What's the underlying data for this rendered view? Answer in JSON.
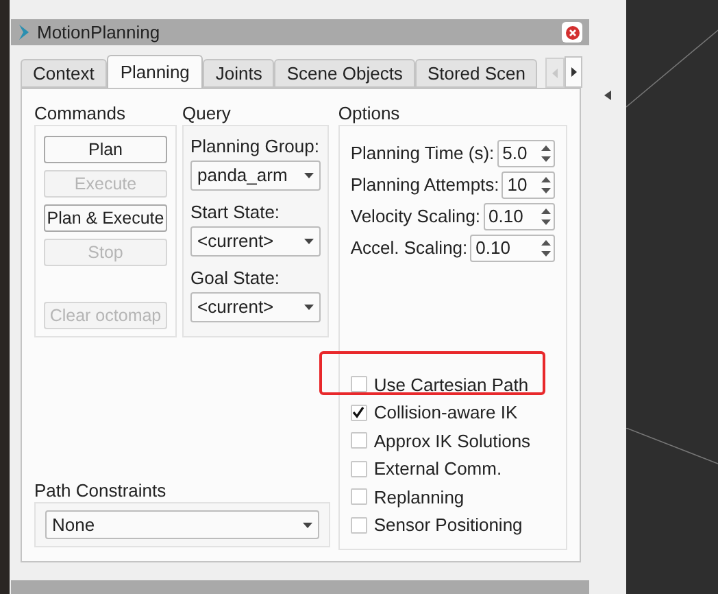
{
  "window": {
    "title": "MotionPlanning"
  },
  "tabs": [
    {
      "label": "Context",
      "selected": false
    },
    {
      "label": "Planning",
      "selected": true
    },
    {
      "label": "Joints",
      "selected": false
    },
    {
      "label": "Scene Objects",
      "selected": false
    },
    {
      "label": "Stored Scen",
      "selected": false
    }
  ],
  "commands": {
    "title": "Commands",
    "buttons": [
      {
        "label": "Plan",
        "disabled": false
      },
      {
        "label": "Execute",
        "disabled": true
      },
      {
        "label": "Plan & Execute",
        "disabled": false
      },
      {
        "label": "Stop",
        "disabled": true
      },
      {
        "label": "Clear octomap",
        "disabled": true
      }
    ]
  },
  "query": {
    "title": "Query",
    "fields": [
      {
        "label": "Planning Group:",
        "value": "panda_arm"
      },
      {
        "label": "Start State:",
        "value": "<current>"
      },
      {
        "label": "Goal State:",
        "value": "<current>"
      }
    ]
  },
  "options": {
    "title": "Options",
    "spinners": [
      {
        "label": "Planning Time (s):",
        "value": "5.0"
      },
      {
        "label": "Planning Attempts:",
        "value": "10"
      },
      {
        "label": "Velocity Scaling:",
        "value": "0.10"
      },
      {
        "label": "Accel. Scaling:",
        "value": "0.10"
      }
    ],
    "checkboxes": [
      {
        "label": "Use Cartesian Path",
        "checked": false,
        "highlighted": true
      },
      {
        "label": "Collision-aware IK",
        "checked": true,
        "highlighted": false
      },
      {
        "label": "Approx IK Solutions",
        "checked": false,
        "highlighted": false
      },
      {
        "label": "External Comm.",
        "checked": false,
        "highlighted": false
      },
      {
        "label": "Replanning",
        "checked": false,
        "highlighted": false
      },
      {
        "label": "Sensor Positioning",
        "checked": false,
        "highlighted": false
      }
    ]
  },
  "path_constraints": {
    "label": "Path Constraints",
    "value": "None"
  }
}
